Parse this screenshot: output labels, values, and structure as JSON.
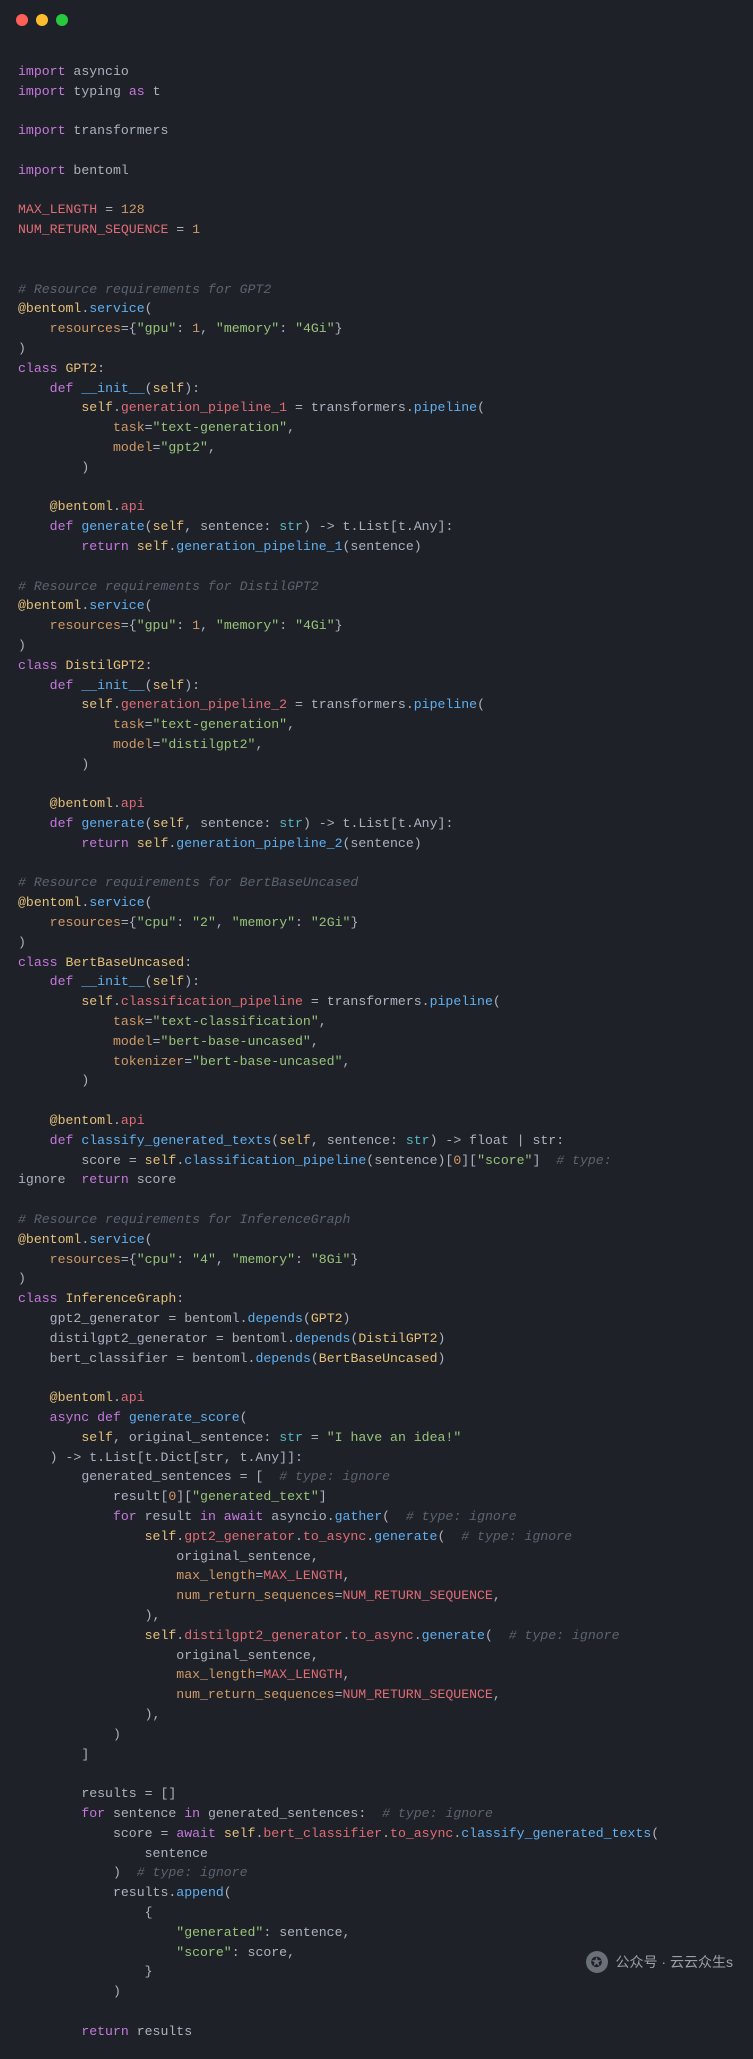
{
  "watermark": {
    "label": "公众号 · 云云众生s"
  },
  "code": {
    "imports": {
      "async": "asyncio",
      "typing": "typing",
      "typing_alias": "t",
      "transformers": "transformers",
      "bentoml": "bentoml"
    },
    "constants": {
      "max_len_name": "MAX_LENGTH",
      "max_len_val": "128",
      "nrs_name": "NUM_RETURN_SEQUENCE",
      "nrs_val": "1"
    },
    "gpt2": {
      "comment": "# Resource requirements for GPT2",
      "res_gpu": "1",
      "res_mem": "\"4Gi\"",
      "cls": "GPT2",
      "pipe_attr": "generation_pipeline_1",
      "task": "\"text-generation\"",
      "model": "\"gpt2\"",
      "api_fn": "generate",
      "api_ret": "t.List[t.Any]"
    },
    "distil": {
      "comment": "# Resource requirements for DistilGPT2",
      "res_gpu": "1",
      "res_mem": "\"4Gi\"",
      "cls": "DistilGPT2",
      "pipe_attr": "generation_pipeline_2",
      "task": "\"text-generation\"",
      "model": "\"distilgpt2\"",
      "api_fn": "generate",
      "api_ret": "t.List[t.Any]"
    },
    "bert": {
      "comment": "# Resource requirements for BertBaseUncased",
      "res_cpu": "\"2\"",
      "res_mem": "\"2Gi\"",
      "cls": "BertBaseUncased",
      "pipe_attr": "classification_pipeline",
      "task": "\"text-classification\"",
      "model": "\"bert-base-uncased\"",
      "tokenizer": "\"bert-base-uncased\"",
      "api_fn": "classify_generated_texts",
      "api_ret": "float | str",
      "score_key": "\"score\""
    },
    "graph": {
      "comment": "# Resource requirements for InferenceGraph",
      "res_cpu": "\"4\"",
      "res_mem": "\"8Gi\"",
      "cls": "InferenceGraph",
      "dep1": "gpt2_generator",
      "dep1_cls": "GPT2",
      "dep2": "distilgpt2_generator",
      "dep2_cls": "DistilGPT2",
      "dep3": "bert_classifier",
      "dep3_cls": "BertBaseUncased",
      "api_fn": "generate_score",
      "default_sentence": "\"I have an idea!\"",
      "ret_type": "t.List[t.Dict[str, t.Any]]",
      "gen_text_key": "\"generated_text\"",
      "comment_ignore": "# type: ignore",
      "comment_ignore2": "# type:",
      "ignore_word": "ignore",
      "gen_key": "\"generated\"",
      "score_key": "\"score\""
    }
  }
}
